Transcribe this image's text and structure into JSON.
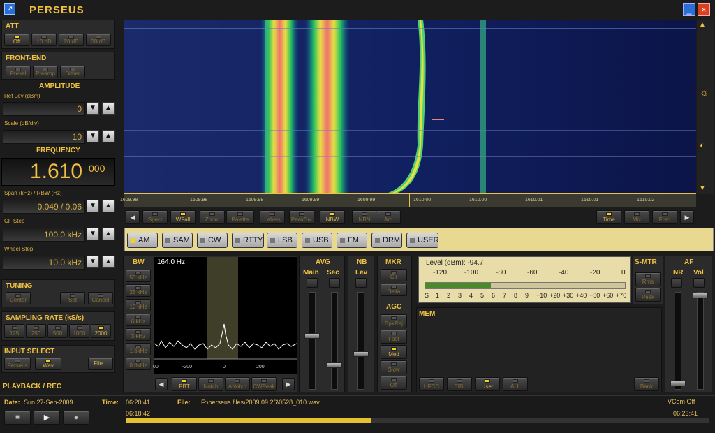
{
  "app": {
    "title": "PERSEUS"
  },
  "att": {
    "title": "ATT",
    "buttons": [
      {
        "label": "Off",
        "on": true
      },
      {
        "label": "10 dB",
        "on": false
      },
      {
        "label": "20 dB",
        "on": false
      },
      {
        "label": "30 dB",
        "on": false
      }
    ]
  },
  "frontend": {
    "title": "FRONT-END",
    "buttons": [
      {
        "label": "Presel",
        "on": false
      },
      {
        "label": "Preamp",
        "on": false
      },
      {
        "label": "Dither",
        "on": false
      }
    ]
  },
  "amplitude": {
    "title": "AMPLITUDE",
    "ref_label": "Ref Lev (dBm)",
    "ref_value": "0",
    "scale_label": "Scale (dB/div)",
    "scale_value": "10"
  },
  "frequency": {
    "title": "FREQUENCY",
    "main": "1.610",
    "sub": "000",
    "span_label": "Span (kHz) / RBW (Hz)",
    "span_value": "0.049 / 0.06",
    "cf_label": "CF Step",
    "cf_value": "100.0 kHz",
    "wheel_label": "Wheel Step",
    "wheel_value": "10.0 kHz"
  },
  "tuning": {
    "title": "TUNING",
    "buttons": [
      "Center",
      "Set",
      "Cancel"
    ]
  },
  "sampling": {
    "title": "SAMPLING RATE (kS/s)",
    "buttons": [
      {
        "label": "125",
        "on": false
      },
      {
        "label": "250",
        "on": false
      },
      {
        "label": "500",
        "on": false
      },
      {
        "label": "1000",
        "on": false
      },
      {
        "label": "2000",
        "on": true
      }
    ]
  },
  "input": {
    "title": "INPUT SELECT",
    "buttons": [
      {
        "label": "Perseus",
        "on": false
      },
      {
        "label": "Wav",
        "on": true
      }
    ],
    "file_label": "File..."
  },
  "playback": {
    "title": "PLAYBACK / REC"
  },
  "freq_axis": [
    "1609.98",
    "1609.98",
    "1609.98",
    "1609.99",
    "1609.99",
    "1610.00",
    "1610.00",
    "1610.01",
    "1610.01",
    "1610.02"
  ],
  "toolbar": [
    {
      "label": "Spect",
      "on": false
    },
    {
      "label": "WFall",
      "on": true
    },
    {
      "label": "Zoom",
      "on": false
    },
    {
      "label": "Palette",
      "on": false
    },
    {
      "label": "Labels",
      "on": false
    },
    {
      "label": "PeakSrc",
      "on": false
    },
    {
      "label": "NBW",
      "on": true
    },
    {
      "label": "NBN",
      "on": false
    },
    {
      "label": "Arc",
      "on": false
    }
  ],
  "toolbar_right": [
    {
      "label": "Time",
      "on": true
    },
    {
      "label": "Mix",
      "on": false
    },
    {
      "label": "Freq",
      "on": false
    }
  ],
  "modes": [
    {
      "label": "AM",
      "on": true
    },
    {
      "label": "SAM",
      "on": false
    },
    {
      "label": "CW",
      "on": false
    },
    {
      "label": "RTTY",
      "on": false
    },
    {
      "label": "LSB",
      "on": false
    },
    {
      "label": "USB",
      "on": false
    },
    {
      "label": "FM",
      "on": false
    },
    {
      "label": "DRM",
      "on": false
    },
    {
      "label": "USER",
      "on": false
    }
  ],
  "bw": {
    "title": "BW",
    "buttons": [
      "50 kHz",
      "25 kHz",
      "12 kHz",
      "6 kHz",
      "3 kHz",
      "1.6kHz",
      "0.8kHz"
    ],
    "display": "164.0 Hz",
    "axis": [
      "00",
      "-200",
      "0",
      "200"
    ],
    "bottom_buttons": [
      {
        "label": "PBT",
        "on": true
      },
      {
        "label": "Notch",
        "on": false
      },
      {
        "label": "ANotch",
        "on": false
      },
      {
        "label": "CWPeak",
        "on": false
      }
    ]
  },
  "avg": {
    "title": "AVG",
    "main": "Main",
    "sec": "Sec"
  },
  "nb": {
    "title": "NB",
    "lev": "Lev"
  },
  "mkr": {
    "title": "MKR",
    "buttons": [
      "Clr",
      "Delta"
    ]
  },
  "agc": {
    "title": "AGC",
    "buttons": [
      {
        "label": "SpkRej",
        "on": false
      },
      {
        "label": "Fast",
        "on": false
      },
      {
        "label": "Med",
        "on": true
      },
      {
        "label": "Slow",
        "on": false
      },
      {
        "label": "Off",
        "on": false
      }
    ]
  },
  "smeter": {
    "level_label": "Level (dBm):",
    "level_value": "-94.7",
    "db_scale": [
      "-120",
      "-100",
      "-80",
      "-60",
      "-40",
      "-20",
      "0"
    ],
    "s_scale": [
      "S",
      "1",
      "2",
      "3",
      "4",
      "5",
      "6",
      "7",
      "8",
      "9",
      "+10",
      "+20",
      "+30",
      "+40",
      "+50",
      "+60",
      "+70"
    ],
    "fill": 0.33
  },
  "smtr": {
    "title": "S-MTR",
    "buttons": [
      "Rms",
      "Peak"
    ]
  },
  "af": {
    "title": "AF",
    "nr": "NR",
    "vol": "Vol"
  },
  "mem": {
    "title": "MEM",
    "buttons": [
      {
        "label": "HFCC",
        "on": false
      },
      {
        "label": "EIBI",
        "on": false
      },
      {
        "label": "User",
        "on": true
      },
      {
        "label": "ALL",
        "on": false
      }
    ],
    "bank": "Bank"
  },
  "status": {
    "date_label": "Date:",
    "date": "Sun 27-Sep-2009",
    "time_label": "Time:",
    "time": "06:20:41",
    "file_label": "File:",
    "file": "F:\\perseus files\\2009.09.26\\0528_010.wav",
    "vcom": "VCom Off",
    "start": "06:18:42",
    "end": "06:23:41",
    "progress": 0.42
  }
}
